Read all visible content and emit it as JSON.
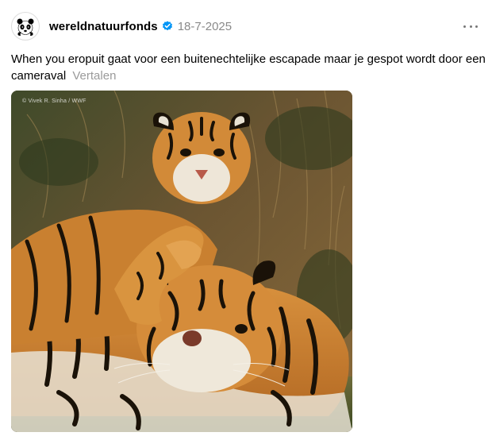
{
  "post": {
    "username": "wereldnatuurfonds",
    "date": "18-7-2025",
    "caption": "When you eropuit gaat voor een buitenechtelijke escapade maar je gespot wordt door een cameraval",
    "translate_label": "Vertalen",
    "photo_watermark": "© Vivek R. Sinha / WWF",
    "icons": {
      "avatar": "panda-logo",
      "verified": "verified-badge-icon",
      "more": "more-options-icon"
    },
    "colors": {
      "verified_blue": "#0095f6",
      "date_gray": "#8a8a8a",
      "translate_gray": "#9a9a9a"
    }
  }
}
